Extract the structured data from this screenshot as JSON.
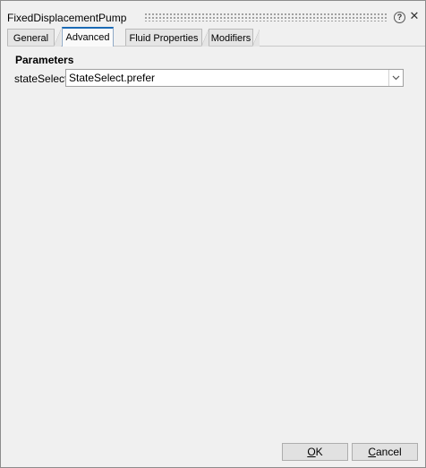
{
  "window": {
    "title": "FixedDisplacementPump",
    "help_glyph": "?",
    "close_glyph": "✕"
  },
  "tabs": [
    {
      "label": "General",
      "active": false
    },
    {
      "label": "Advanced",
      "active": true
    },
    {
      "label": "Fluid Properties",
      "active": false
    },
    {
      "label": "Modifiers",
      "active": false
    }
  ],
  "parameters": {
    "section_title": "Parameters",
    "rows": [
      {
        "label": "stateSelect",
        "value": "StateSelect.prefer"
      }
    ]
  },
  "buttons": {
    "ok": {
      "mnemonic": "O",
      "rest": "K"
    },
    "cancel": {
      "mnemonic": "C",
      "rest": "ancel"
    }
  },
  "colors": {
    "active_tab_accent": "#1a6ab5",
    "background": "#f0f0f0"
  }
}
